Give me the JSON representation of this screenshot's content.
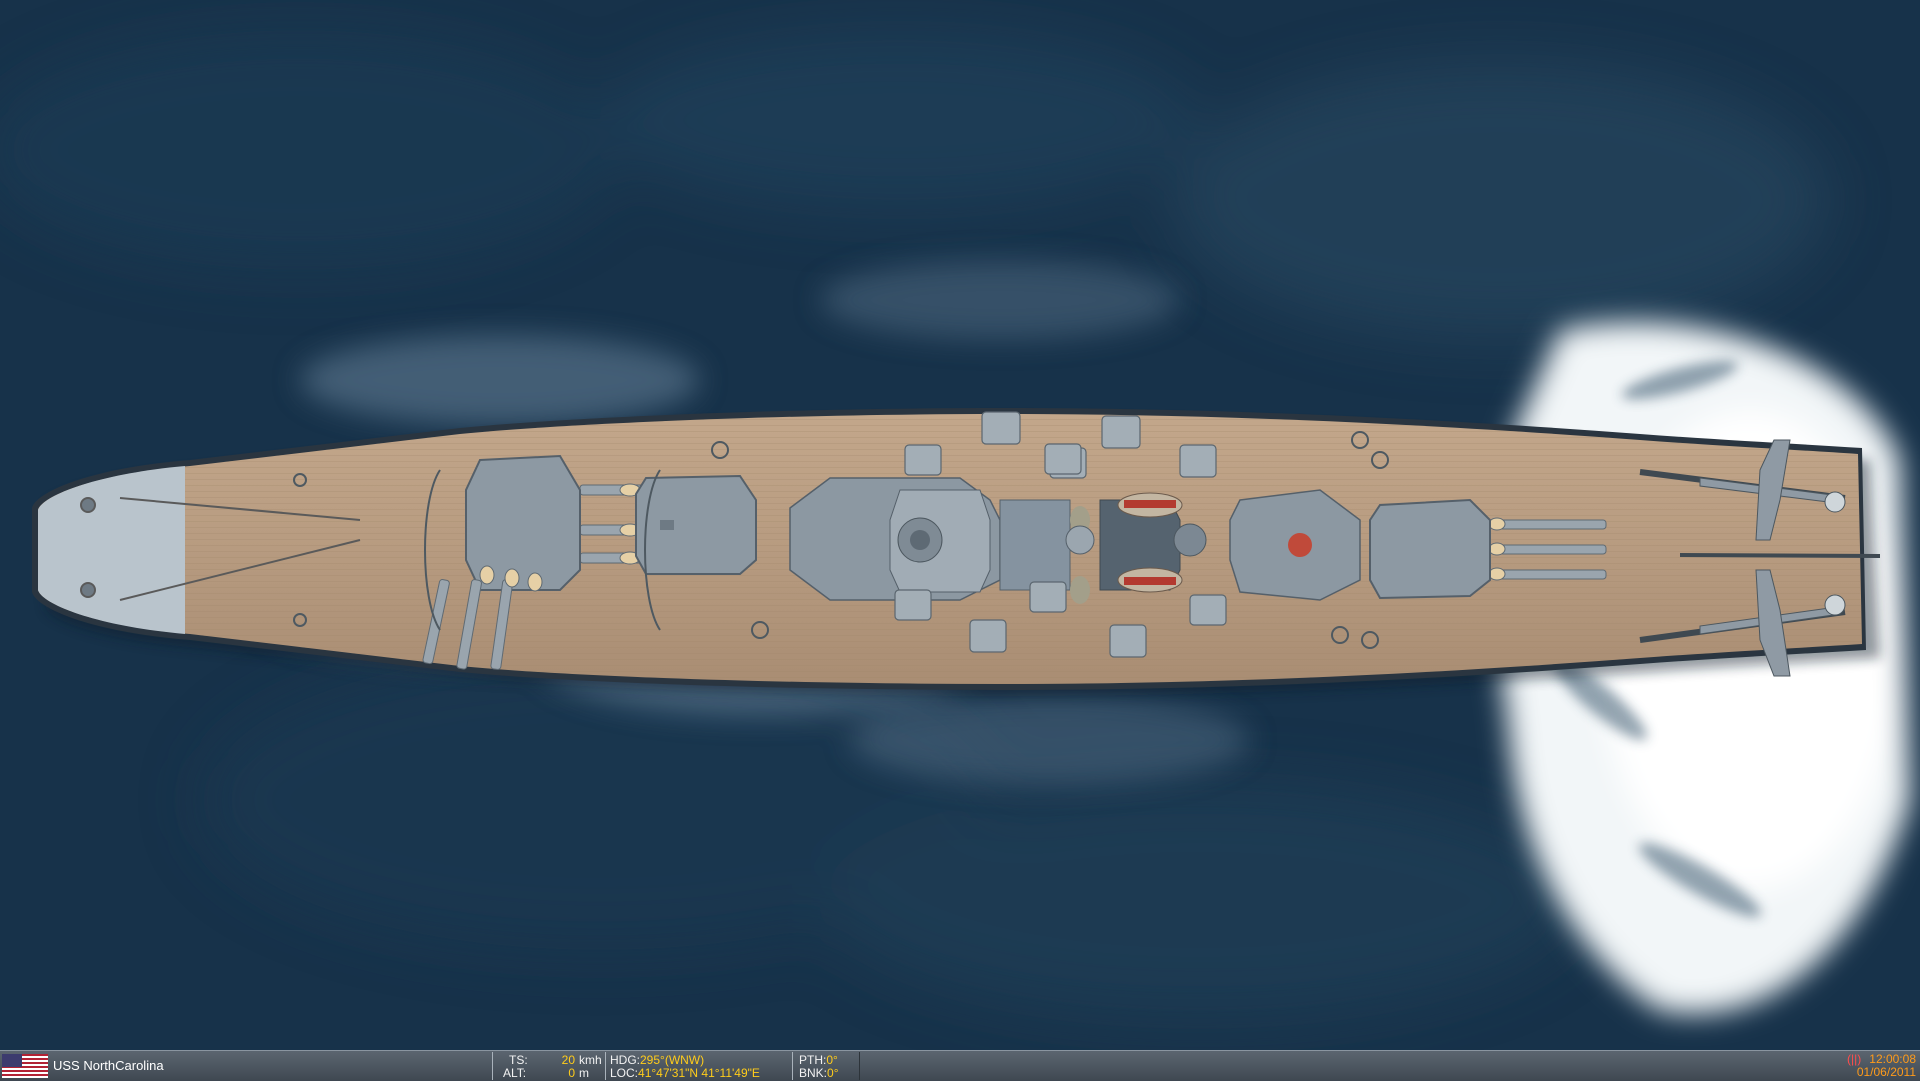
{
  "vehicle": {
    "name": "USS NorthCarolina",
    "flag_icon": "us-flag-icon"
  },
  "telemetry": {
    "ts_label": "TS:",
    "ts_value": "20",
    "ts_unit": "kmh",
    "alt_label": "ALT:",
    "alt_value": "0",
    "alt_unit": "m",
    "hdg_label": "HDG:",
    "hdg_value": "295°(WNW)",
    "loc_label": "LOC:",
    "loc_value": "41°47'31\"N 41°11'49\"E",
    "pth_label": "PTH:",
    "pth_value": "0°",
    "bnk_label": "BNK:",
    "bnk_value": "0°"
  },
  "clock": {
    "pause_icon": "(||)",
    "time": "12:00:08",
    "date": "01/06/2011"
  },
  "colors": {
    "value_yellow": "#ffcc1a",
    "clock_orange": "#ff9b1a",
    "sea": "#17324a",
    "deck": "#b89c80"
  }
}
